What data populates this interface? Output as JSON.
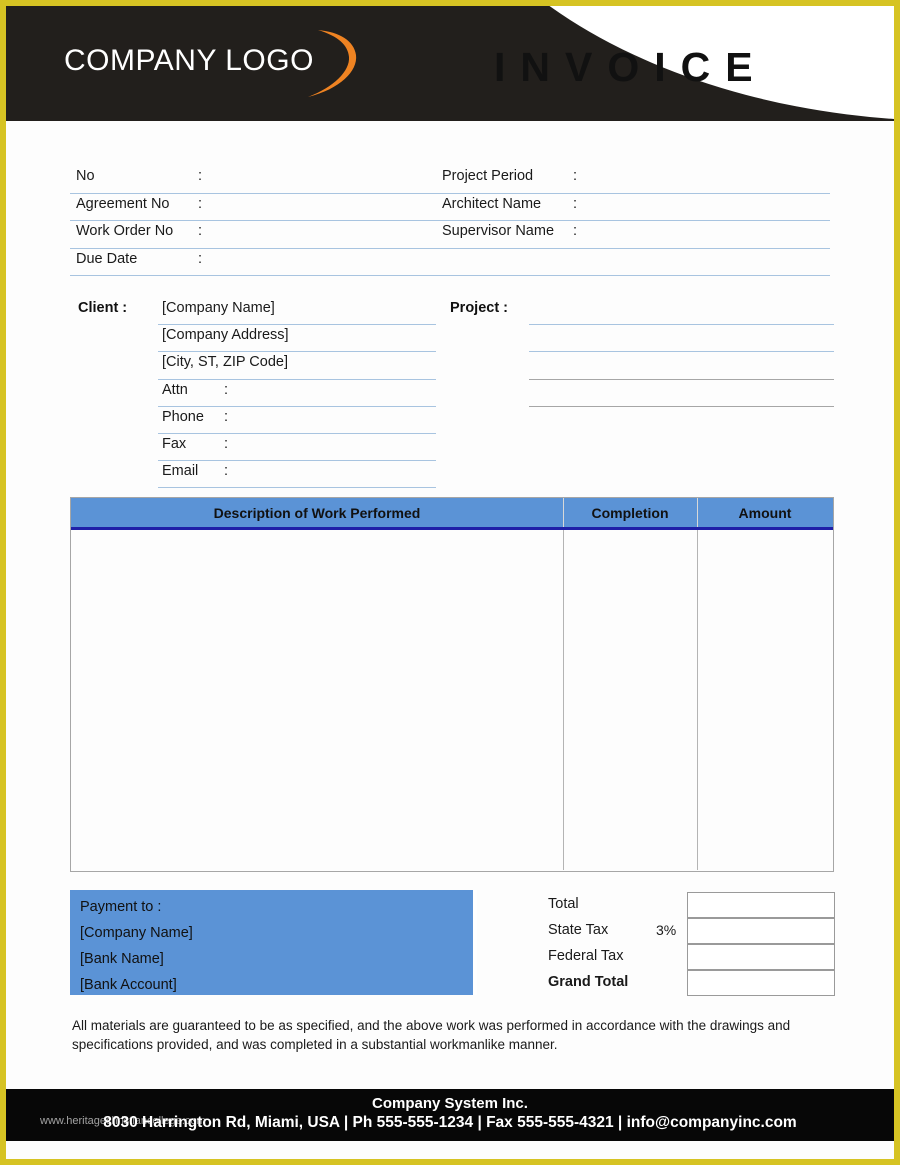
{
  "document": {
    "title": "INVOICE",
    "logo_text": "COMPANY LOGO",
    "logo_icon": "orange-swoosh-icon",
    "border_color": "#d6c323",
    "header_bg": "#221f1c",
    "accent_blue": "#5b93d6",
    "accent_navy": "#1f1fa8",
    "line_blue": "#a8c4e0",
    "footer_bg": "#070707",
    "logo_swoosh_color": "#ef8322"
  },
  "fields": {
    "left": [
      {
        "label": "No",
        "colon": ":",
        "value": ""
      },
      {
        "label": "Agreement No",
        "colon": ":",
        "value": ""
      },
      {
        "label": "Work Order No",
        "colon": ":",
        "value": ""
      },
      {
        "label": "Due Date",
        "colon": ":",
        "value": ""
      }
    ],
    "right": [
      {
        "label": "Project Period",
        "colon": ":",
        "value": ""
      },
      {
        "label": "Architect Name",
        "colon": ":",
        "value": ""
      },
      {
        "label": "Supervisor Name",
        "colon": ":",
        "value": ""
      }
    ]
  },
  "client": {
    "title": "Client  :",
    "lines": [
      {
        "text": "[Company Name]",
        "colon": ""
      },
      {
        "text": "[Company Address]",
        "colon": ""
      },
      {
        "text": "[City, ST, ZIP Code]",
        "colon": ""
      },
      {
        "text": "Attn",
        "colon": ":"
      },
      {
        "text": "Phone",
        "colon": ":"
      },
      {
        "text": "Fax",
        "colon": ":"
      },
      {
        "text": "Email",
        "colon": ":"
      }
    ]
  },
  "project": {
    "title": "Project  :",
    "lines": [
      "",
      "",
      "",
      ""
    ]
  },
  "work_table": {
    "columns": [
      "Description of Work Performed",
      "Completion",
      "Amount"
    ],
    "rows": []
  },
  "payment": {
    "heading": "Payment to :",
    "lines": [
      "[Company Name]",
      "[Bank Name]",
      "[Bank Account]"
    ]
  },
  "totals": [
    {
      "label": "Total",
      "percent": "",
      "value": "",
      "bold": false
    },
    {
      "label": "State Tax",
      "percent": "3%",
      "value": "",
      "bold": false
    },
    {
      "label": "Federal Tax",
      "percent": "",
      "value": "",
      "bold": false
    },
    {
      "label": "Grand Total",
      "percent": "",
      "value": "",
      "bold": true
    }
  ],
  "guarantee": "All materials are guaranteed to be as specified, and the above work was performed in accordance with the drawings and specifications provided, and was completed in a substantial workmanlike manner.",
  "footer": {
    "company": "Company System Inc.",
    "address": "8030 Harrington Rd, Miami, USA | Ph 555-555-1234 | Fax 555-555-4321 | info@companyinc.com",
    "watermark": "www.heritagechristiancollege.com"
  }
}
